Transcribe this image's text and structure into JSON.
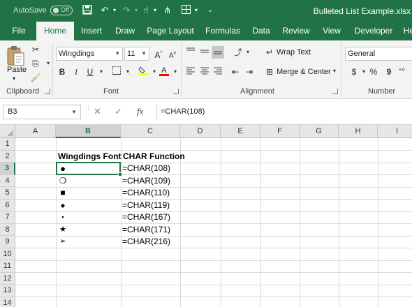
{
  "titlebar": {
    "autosave_label": "AutoSave",
    "autosave_state": "Off",
    "filename": "Bulleted List Example.xlsx"
  },
  "ribbon_tabs": [
    "File",
    "Home",
    "Insert",
    "Draw",
    "Page Layout",
    "Formulas",
    "Data",
    "Review",
    "View",
    "Developer",
    "Help"
  ],
  "active_tab": "Home",
  "ribbon": {
    "clipboard": {
      "paste_label": "Paste",
      "group_label": "Clipboard"
    },
    "font": {
      "font_name": "Wingdings",
      "font_size": "11",
      "bold": "B",
      "italic": "I",
      "underline": "U",
      "grow": "A",
      "shrink": "A",
      "group_label": "Font"
    },
    "alignment": {
      "wrap_text": "Wrap Text",
      "merge_center": "Merge & Center",
      "group_label": "Alignment"
    },
    "number": {
      "format": "General",
      "currency": "$",
      "percent": "%",
      "comma": "9",
      "group_label": "Number"
    }
  },
  "formula_bar": {
    "name_box": "B3",
    "cancel_symbol": "✕",
    "enter_symbol": "✓",
    "fx_symbol": "fx",
    "formula": "=CHAR(108)"
  },
  "sheet": {
    "columns": [
      "A",
      "B",
      "C",
      "D",
      "E",
      "F",
      "G",
      "H",
      "I"
    ],
    "selected_column": "B",
    "rows": [
      "1",
      "2",
      "3",
      "4",
      "5",
      "6",
      "7",
      "8",
      "9",
      "10",
      "11",
      "12",
      "13",
      "14"
    ],
    "selected_row": "3",
    "header_b": "Wingdings Font",
    "header_c": "CHAR Function",
    "data_rows": [
      {
        "bullet": "●",
        "formula": "=CHAR(108)"
      },
      {
        "bullet": "❍",
        "formula": "=CHAR(109)"
      },
      {
        "bullet": "■",
        "formula": "=CHAR(110)"
      },
      {
        "bullet": "◆",
        "formula": "=CHAR(119)"
      },
      {
        "bullet": "▪",
        "formula": "=CHAR(167)"
      },
      {
        "bullet": "★",
        "formula": "=CHAR(171)"
      },
      {
        "bullet": "➢",
        "formula": "=CHAR(216)"
      }
    ]
  },
  "colors": {
    "accent": "#217346",
    "header_bg": "#e6e6e6",
    "gridline": "#d9d9d9"
  }
}
